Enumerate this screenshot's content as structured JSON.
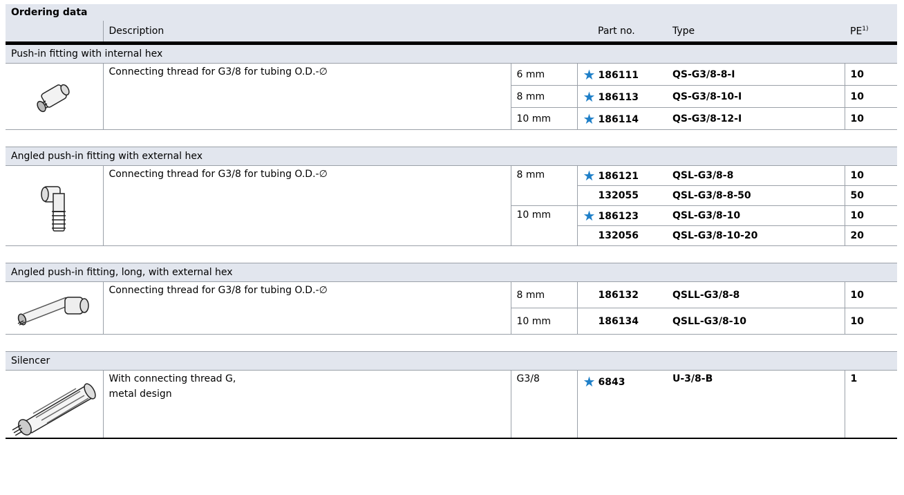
{
  "title": "Ordering data",
  "headers": {
    "description": "Description",
    "part_no": "Part no.",
    "type": "Type",
    "pe": "PE",
    "pe_sup": "1)"
  },
  "groups": [
    {
      "name": "Push-in fitting with internal hex",
      "image_icon": "straight-fitting-icon",
      "description": "Connecting thread for G3/8   for tubing O.D.-∅",
      "description_line2": "",
      "rows": [
        {
          "size": "6 mm",
          "star": true,
          "part_no": "186111",
          "type": "QS-G3/8-8-I",
          "pe": "10"
        },
        {
          "size": "8 mm",
          "star": true,
          "part_no": "186113",
          "type": "QS-G3/8-10-I",
          "pe": "10"
        },
        {
          "size": "10 mm",
          "star": true,
          "part_no": "186114",
          "type": "QS-G3/8-12-I",
          "pe": "10"
        }
      ]
    },
    {
      "name": "Angled push-in fitting with external hex",
      "image_icon": "angled-fitting-icon",
      "description": "Connecting thread for G3/8   for tubing O.D.-∅",
      "description_line2": "",
      "rows": [
        {
          "size": "8 mm",
          "star": true,
          "part_no": "186121",
          "type": "QSL-G3/8-8",
          "pe": "10"
        },
        {
          "size": "",
          "star": false,
          "part_no": "132055",
          "type": "QSL-G3/8-8-50",
          "pe": "50"
        },
        {
          "size": "10 mm",
          "star": true,
          "part_no": "186123",
          "type": "QSL-G3/8-10",
          "pe": "10"
        },
        {
          "size": "",
          "star": false,
          "part_no": "132056",
          "type": "QSL-G3/8-10-20",
          "pe": "20"
        }
      ]
    },
    {
      "name": "Angled push-in fitting, long, with external hex",
      "image_icon": "long-angled-fitting-icon",
      "description": "Connecting thread for G3/8   for tubing O.D.-∅",
      "description_line2": "",
      "rows": [
        {
          "size": "8 mm",
          "star": false,
          "part_no": "186132",
          "type": "QSLL-G3/8-8",
          "pe": "10"
        },
        {
          "size": "10 mm",
          "star": false,
          "part_no": "186134",
          "type": "QSLL-G3/8-10",
          "pe": "10"
        }
      ]
    },
    {
      "name": "Silencer",
      "image_icon": "silencer-icon",
      "description": "With connecting thread G,",
      "description_line2": "metal design",
      "rows": [
        {
          "size": "G3/8",
          "star": true,
          "part_no": "6843",
          "type": "U-3/8-B",
          "pe": "1"
        }
      ]
    }
  ],
  "colors": {
    "header_bg": "#e2e6ee",
    "star": "#1e7fc8",
    "rule": "#000000"
  }
}
